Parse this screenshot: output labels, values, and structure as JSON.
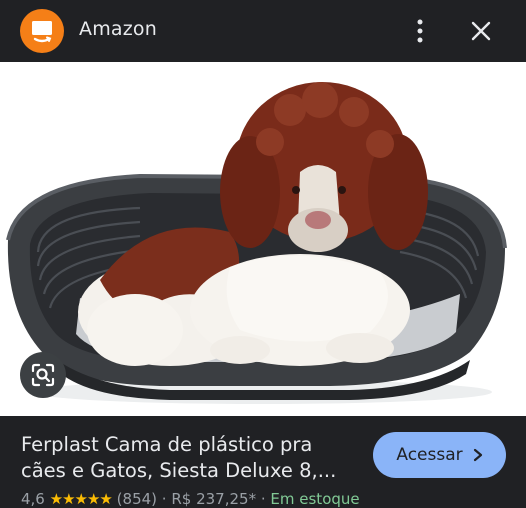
{
  "header": {
    "title": "Amazon",
    "app_icon": "amazon-smile-logo",
    "more_icon": "more-vert-icon",
    "close_icon": "close-icon"
  },
  "image": {
    "subject": "puppy-in-plastic-pet-bed",
    "lens_icon": "google-lens-icon"
  },
  "product": {
    "title_line1": "Ferplast Cama de plástico pra",
    "title_line2": "cães e Gatos, Siesta Deluxe 8,...",
    "visit_label": "Acessar",
    "rating": "4,6",
    "stars": "★★★★★",
    "reviews": "(854)",
    "price": "R$ 237,25*",
    "stock": "Em estoque"
  },
  "colors": {
    "accent": "#8ab4f8",
    "amazon_orange": "#f57f17",
    "star": "#fbbc04",
    "in_stock": "#81c995"
  }
}
